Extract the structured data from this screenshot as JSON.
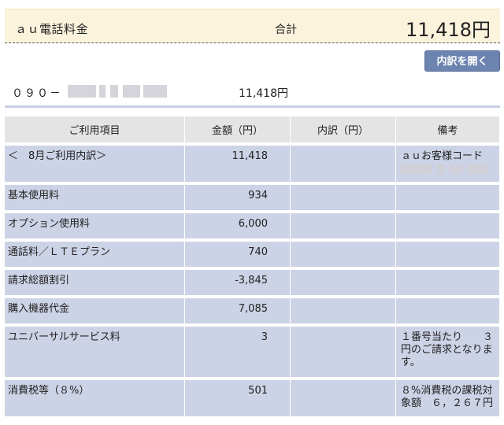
{
  "header": {
    "title": "ａｕ電話料金",
    "total_label": "合計",
    "total_value": "11,418円"
  },
  "detail_button": "内訳を開く",
  "line": {
    "phone_prefix": "０９０－",
    "amount": "11,418円"
  },
  "table": {
    "headers": [
      "ご利用項目",
      "金額（円）",
      "内訳（円）",
      "備考"
    ],
    "rows": [
      {
        "item": "＜　8月ご利用内訳＞",
        "amount": "11,418",
        "breakdown": "",
        "note": "ａｕお客様コード"
      },
      {
        "item": "基本使用料",
        "amount": "934",
        "breakdown": "",
        "note": ""
      },
      {
        "item": "オプション使用料",
        "amount": "6,000",
        "breakdown": "",
        "note": ""
      },
      {
        "item": "通話料／ＬＴＥプラン",
        "amount": "740",
        "breakdown": "",
        "note": ""
      },
      {
        "item": "請求総額割引",
        "amount": "-3,845",
        "breakdown": "",
        "note": ""
      },
      {
        "item": "購入機器代金",
        "amount": "7,085",
        "breakdown": "",
        "note": ""
      },
      {
        "item": "ユニバーサルサービス料",
        "amount": "3",
        "breakdown": "",
        "note": "１番号当たり　　３円のご請求となります。"
      },
      {
        "item": "消費税等（８%）",
        "amount": "501",
        "breakdown": "",
        "note": "８%消費税の課税対象額　６，２６７円"
      }
    ]
  }
}
